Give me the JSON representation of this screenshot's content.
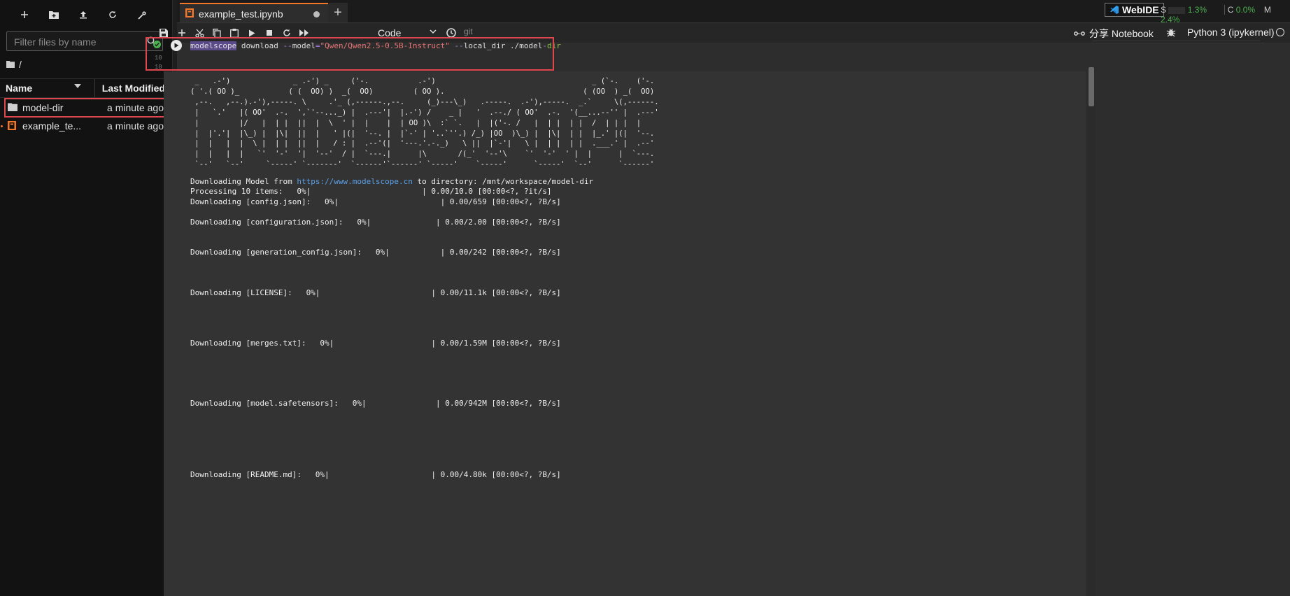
{
  "sidebar": {
    "filter_placeholder": "Filter files by name",
    "breadcrumb": "/",
    "col_name": "Name",
    "col_modified": "Last Modified",
    "files": [
      {
        "name": "model-dir",
        "modified": "a minute ago",
        "icon": "folder-icon"
      },
      {
        "name": "example_te...",
        "modified": "a minute ago",
        "icon": "notebook-icon"
      }
    ]
  },
  "tab": {
    "title": "example_test.ipynb",
    "new_tab": "+"
  },
  "toolbar": {
    "cell_type": "Code",
    "git": "git",
    "share_notebook": "分享 Notebook",
    "kernel": "Python 3 (ipykernel)"
  },
  "status": {
    "webide": "WebIDE",
    "s_label": "S",
    "s_value": "1.3%",
    "c_label": "C",
    "c_value": "0.0%",
    "m_label": "M",
    "m_value": "2.4%"
  },
  "cell": {
    "line_numbers": [
      "10",
      "10"
    ],
    "code": {
      "cmd": "modelscope",
      "sub": " download ",
      "flag1": "--",
      "p1": "model",
      "eq": "=",
      "model": "\"Qwen/Qwen2.5-0.5B-Instruct\"",
      "space": " ",
      "flag2": "--",
      "p2": "local_dir ./model",
      "dash": "-",
      "dir": "dir"
    }
  },
  "output": {
    "ascii_art": " _   .-')              _ .-') _     ('-.           .-')                                   _ (`-.    ('-.   \n( '.( OO )_           ( (  OO) )  _(  OO)         ( OO ).                               ( (OO  ) _(  OO)  \n ,--.   ,--.).-'),-----. \\     .'_ (,------.,--.     (_)---\\_)   .-----.  .-'),-----.  _.`     \\(,------. \n |   `.'   |( OO'  .-.  ',`'--..._) |  .---'|  |.-') /    _ |   '  .--./ ( OO'  .-.  '(__...--'' |  .---' \n |         |/   |  | |  ||  |  \\  ' |  |    |  | OO )\\  :` `.   |  |('-. /   |  | |  | |  /  | | |  |     \n |  |'.'|  |\\_) |  |\\|  ||  |   ' |(|  '--. |  |`-' | '..`''.) /_) |OO  )\\_) |  |\\|  | |  |_.' |(|  '--.  \n |  |   |  |  \\ |  | |  ||  |   / : |  .--'(|  '---.'.-._)   \\ ||  |`-'|   \\ |  | |  | |  .___.' |  .--'  \n |  |   |  |   `'  '-'  '|  '--'  / |  `---.|      |\\       /(_'  '--'\\    `'  '-'  ' |  |      |  `---. \n `--'   `--'     `-----' `-------'  `------'`------' `-----'    `-----'      `-----'  `--'      `------' ",
    "download_prefix": "Downloading Model from ",
    "download_url": "https://www.modelscope.cn",
    "download_suffix": " to directory: /mnt/workspace/model-dir",
    "progress_lines": [
      "Processing 10 items:   0%|                        | 0.00/10.0 [00:00<?, ?it/s]",
      "Downloading [config.json]:   0%|                      | 0.00/659 [00:00<?, ?B/s]",
      "Downloading [configuration.json]:   0%|              | 0.00/2.00 [00:00<?, ?B/s]",
      "Downloading [generation_config.json]:   0%|           | 0.00/242 [00:00<?, ?B/s]",
      "Downloading [LICENSE]:   0%|                        | 0.00/11.1k [00:00<?, ?B/s]",
      "Downloading [merges.txt]:   0%|                     | 0.00/1.59M [00:00<?, ?B/s]",
      "Downloading [model.safetensors]:   0%|               | 0.00/942M [00:00<?, ?B/s]",
      "Downloading [README.md]:   0%|                      | 0.00/4.80k [00:00<?, ?B/s]"
    ]
  },
  "colors": {
    "accent": "#f37726",
    "highlight_box": "#e0464d",
    "link": "#5aa0e8",
    "green": "#4caf50"
  }
}
